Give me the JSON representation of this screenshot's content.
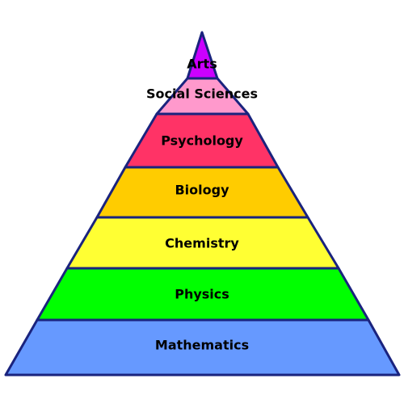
{
  "pyramid": {
    "layers": [
      {
        "label": "Arts",
        "color": "#cc00ff"
      },
      {
        "label": "Social Sciences",
        "color": "#ff99cc"
      },
      {
        "label": "Psychology",
        "color": "#ff3366"
      },
      {
        "label": "Biology",
        "color": "#ffcc00"
      },
      {
        "label": "Chemistry",
        "color": "#ffff33"
      },
      {
        "label": "Physics",
        "color": "#00ff00"
      },
      {
        "label": "Mathematics",
        "color": "#6699ff"
      }
    ],
    "outline_color": "#1a237e"
  }
}
